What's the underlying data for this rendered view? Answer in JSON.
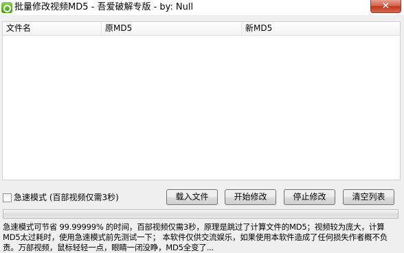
{
  "window": {
    "title": "批量修改视频MD5 - 吾爱破解专版 - by: Null",
    "close_glyph": "✕",
    "app_icon": "app-icon"
  },
  "list": {
    "columns": [
      "文件名",
      "原MD5",
      "新MD5"
    ],
    "rows": []
  },
  "controls": {
    "fast_mode_label": "急速模式 (百部视频仅需3秒)",
    "fast_mode_checked": false,
    "load_button": "载入文件",
    "start_button": "开始修改",
    "stop_button": "停止修改",
    "clear_button": "清空列表"
  },
  "progress": {
    "value": 0
  },
  "info": {
    "lines": [
      "急速模式可节省 99.99999% 的时间，百部视频仅需3秒，原理是跳过了计算文件的MD5；视频较为庞大，计算",
      "MD5太过耗时，使用急速模式前先测试一下； 本软件仅供交流娱乐，如果使用本软件造成了任何损失作者概不负",
      "责。万部视频，鼠标轻轻一点，眼睛一闭没睁，MD5全变了..."
    ]
  },
  "colors": {
    "close_button": "#c7472c",
    "progress_fill": "#37b72a",
    "window_bg": "#f0f0f0"
  }
}
